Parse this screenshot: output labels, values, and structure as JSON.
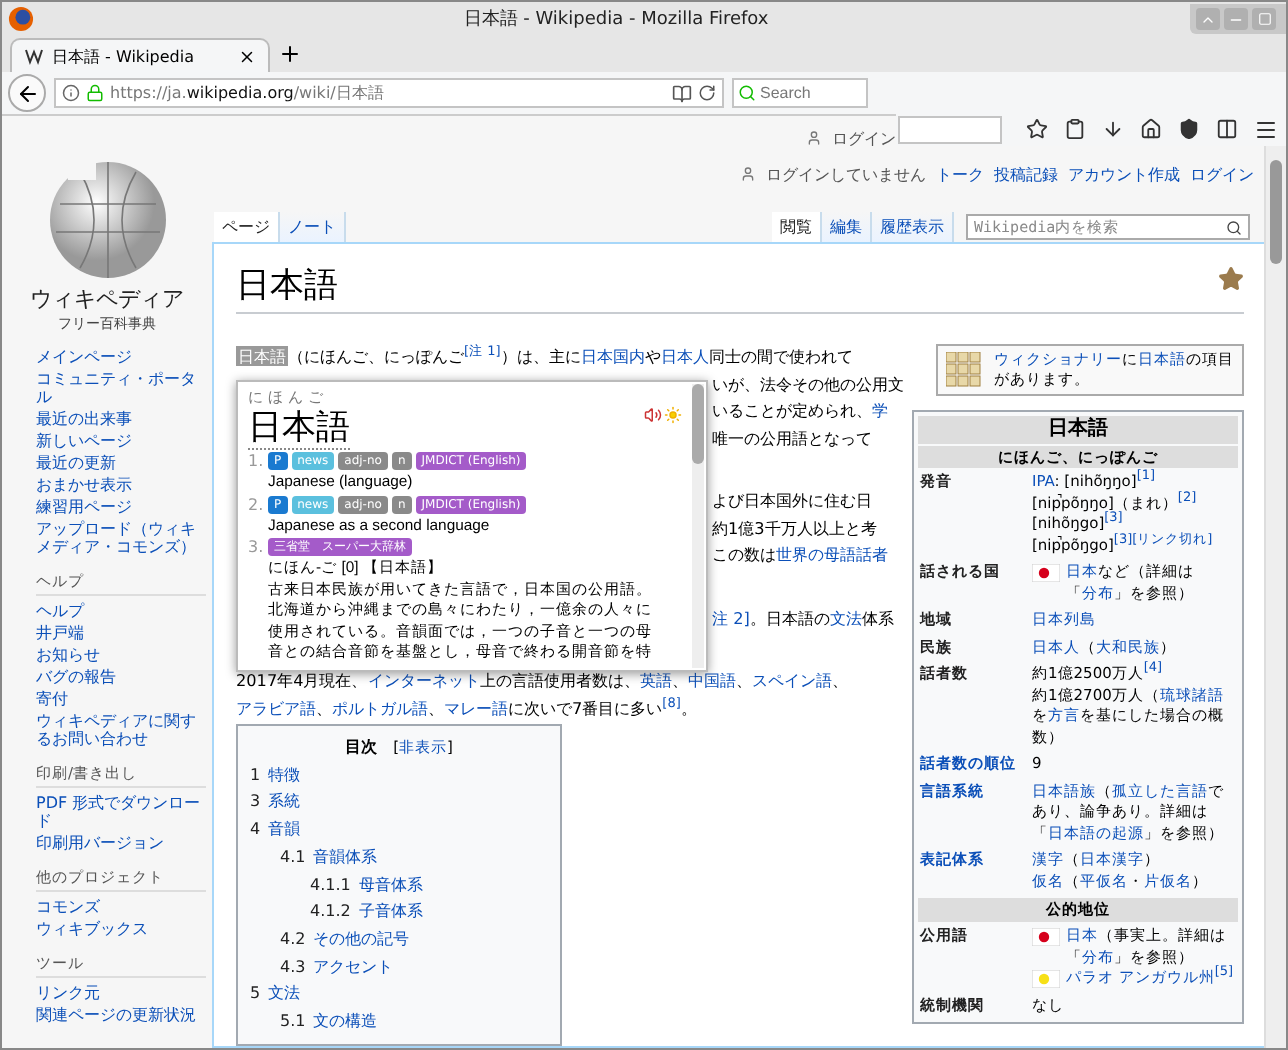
{
  "window": {
    "title": "日本語 - Wikipedia - Mozilla Firefox"
  },
  "tabs": [
    {
      "label": "日本語 - Wikipedia",
      "selected": true
    }
  ],
  "address_bar": {
    "url_prefix": "https://ja.",
    "url_domain": "wikipedia.org",
    "url_path": "/wiki/日本語"
  },
  "search_bar": {
    "placeholder": "Search"
  },
  "personal_bar": {
    "top_link": "ログイン",
    "status": "ログインしていません",
    "links": [
      "トーク",
      "投稿記録",
      "アカウント作成",
      "ログイン"
    ]
  },
  "logo": {
    "name": "ウィキペディア",
    "tagline": "フリー百科事典"
  },
  "sidebar": [
    {
      "items": [
        "メインページ",
        "コミュニティ・ポータル",
        "最近の出来事",
        "新しいページ",
        "最近の更新",
        "おまかせ表示",
        "練習用ページ",
        "アップロード（ウィキメディア・コモンズ）"
      ]
    },
    {
      "heading": "ヘルプ",
      "items": [
        "ヘルプ",
        "井戸端",
        "お知らせ",
        "バグの報告",
        "寄付",
        "ウィキペディアに関するお問い合わせ"
      ]
    },
    {
      "heading": "印刷/書き出し",
      "items": [
        "PDF 形式でダウンロード",
        "印刷用バージョン"
      ]
    },
    {
      "heading": "他のプロジェクト",
      "items": [
        "コモンズ",
        "ウィキブックス"
      ]
    },
    {
      "heading": "ツール",
      "items": [
        "リンク元",
        "関連ページの更新状況"
      ]
    }
  ],
  "page_tabs": [
    {
      "label": "ページ",
      "selected": true
    },
    {
      "label": "ノート",
      "selected": false
    }
  ],
  "view_tabs": [
    {
      "label": "閲覧",
      "selected": true
    },
    {
      "label": "編集",
      "selected": false
    },
    {
      "label": "履歴表示",
      "selected": false
    }
  ],
  "wiki_search": {
    "placeholder": "Wikipedia内を検索"
  },
  "article": {
    "title": "日本語",
    "intro": [
      {
        "kind": "mark",
        "text": "日本語"
      },
      "（にほんご、にっぽんご",
      {
        "kind": "ref",
        "text": "[注 1]"
      },
      "）は、主に",
      {
        "kind": "link",
        "text": "日本国内"
      },
      "や",
      {
        "kind": "link",
        "text": "日本人"
      },
      "同士の間で使われて"
    ],
    "covered_paragraphs": [
      [
        [
          "いが、法令その他の公用文"
        ],
        [
          "いることが定められ、",
          {
            "kind": "link",
            "text": "学"
          }
        ],
        [
          "唯一の公用語となって"
        ]
      ],
      [
        [
          "よび日本国外に住む日"
        ],
        [
          "約1億3千万人以上と考"
        ],
        [
          "この数は",
          {
            "kind": "link",
            "text": "世界の母語話者"
          }
        ]
      ],
      [
        [
          {
            "kind": "link",
            "text": "注 2]"
          },
          "。日本語の",
          {
            "kind": "link",
            "text": "文法"
          },
          "体系"
        ]
      ]
    ],
    "paragraph": [
      [
        "2017年4月現在、",
        {
          "kind": "link",
          "text": "インターネット"
        },
        "上の言語使用者数は、",
        {
          "kind": "link",
          "text": "英語"
        },
        "、",
        {
          "kind": "link",
          "text": "中国語"
        },
        "、",
        {
          "kind": "link",
          "text": "スペイン語"
        },
        "、"
      ],
      [
        {
          "kind": "link",
          "text": "アラビア語"
        },
        "、",
        {
          "kind": "link",
          "text": "ポルトガル語"
        },
        "、",
        {
          "kind": "link",
          "text": "マレー語"
        },
        "に次いで7番目に多い",
        {
          "kind": "ref",
          "text": "[8]"
        },
        "。"
      ]
    ]
  },
  "popup": {
    "reading": "にほんご",
    "word": "日本語",
    "senses": [
      {
        "number": "1.",
        "tags": [
          {
            "label": "P",
            "color": "#1a7ad0"
          },
          {
            "label": "news",
            "color": "#5bc0de"
          },
          {
            "label": "adj-no",
            "color": "#8a8a8a"
          },
          {
            "label": "n",
            "color": "#8a8a8a"
          },
          {
            "label": "JMDICT (English)",
            "color": "#a45bc9"
          }
        ],
        "lines": [
          "Japanese (language)"
        ]
      },
      {
        "number": "2.",
        "tags": [
          {
            "label": "P",
            "color": "#1a7ad0"
          },
          {
            "label": "news",
            "color": "#5bc0de"
          },
          {
            "label": "adj-no",
            "color": "#8a8a8a"
          },
          {
            "label": "n",
            "color": "#8a8a8a"
          },
          {
            "label": "JMDICT (English)",
            "color": "#a45bc9"
          }
        ],
        "lines": [
          "Japanese as a second language"
        ]
      },
      {
        "number": "3.",
        "tags": [
          {
            "label": "三省堂　スーパー大辞林",
            "color": "#a45bc9"
          }
        ],
        "lines": [
          "にほん-ご [0] 【日本語】",
          "古来日本民族が用いてきた言語で，日本国の公用語。",
          "北海道から沖縄までの島々にわたり，一億余の人々に",
          "使用されている。音韻面では，一つの子音と一つの母",
          "音との結合音節を基盤とし，母音で終わる開音節を特"
        ]
      }
    ]
  },
  "wiktionary": [
    {
      "kind": "link",
      "text": "ウィクショナリー"
    },
    "に",
    {
      "kind": "link",
      "text": "日本語"
    },
    "の項目があります。"
  ],
  "infobox": {
    "title": "日本語",
    "subtitle": "にほんご、にっぽんご",
    "rows": [
      {
        "kind": "row",
        "label": "発音",
        "label_link": false,
        "lines": [
          [
            {
              "kind": "link",
              "text": "IPA"
            },
            ": [nihõŋŋo]",
            {
              "kind": "ref",
              "text": "[1]"
            }
          ],
          [
            "[nip̚põŋŋo]（まれ）",
            {
              "kind": "ref",
              "text": "[2]"
            }
          ],
          [
            "[nihõŋgo]",
            {
              "kind": "ref",
              "text": "[3]"
            }
          ],
          [
            "[nip̚põŋgo]",
            {
              "kind": "ref",
              "text": "[3][リンク切れ]"
            }
          ]
        ]
      },
      {
        "kind": "row",
        "label": "話される国",
        "label_link": false,
        "lines": [
          [
            {
              "kind": "flag",
              "color": "#d6001c"
            },
            {
              "kind": "link",
              "text": "日本"
            },
            "など（詳細は「",
            {
              "kind": "link",
              "text": "分布"
            },
            "」を参照）"
          ]
        ]
      },
      {
        "kind": "row",
        "label": "地域",
        "label_link": false,
        "lines": [
          [
            {
              "kind": "link",
              "text": "日本列島"
            }
          ]
        ]
      },
      {
        "kind": "row",
        "label": "民族",
        "label_link": false,
        "lines": [
          [
            {
              "kind": "link",
              "text": "日本人"
            },
            "（",
            {
              "kind": "link",
              "text": "大和民族"
            },
            "）"
          ]
        ]
      },
      {
        "kind": "row",
        "label": "話者数",
        "label_link": false,
        "lines": [
          [
            "約1億2500万人",
            {
              "kind": "ref",
              "text": "[4]"
            }
          ],
          [
            "約1億2700万人（",
            {
              "kind": "link",
              "text": "琉球諸語"
            },
            "を",
            {
              "kind": "link",
              "text": "方言"
            },
            "を基にした場合の概数）"
          ]
        ]
      },
      {
        "kind": "row",
        "label": "話者数の順位",
        "label_link": true,
        "lines": [
          [
            "9"
          ]
        ]
      },
      {
        "kind": "row",
        "label": "言語系統",
        "label_link": true,
        "lines": [
          [
            {
              "kind": "link",
              "text": "日本語族"
            },
            "（",
            {
              "kind": "link",
              "text": "孤立した言語"
            },
            "であり、論争あり。詳細は「",
            {
              "kind": "link",
              "text": "日本語の起源"
            },
            "」を参照）"
          ]
        ]
      },
      {
        "kind": "row",
        "label": "表記体系",
        "label_link": true,
        "lines": [
          [
            {
              "kind": "link",
              "text": "漢字"
            },
            "（",
            {
              "kind": "link",
              "text": "日本漢字"
            },
            "）"
          ],
          [
            {
              "kind": "link",
              "text": "仮名"
            },
            "（",
            {
              "kind": "link",
              "text": "平仮名"
            },
            "・",
            {
              "kind": "link",
              "text": "片仮名"
            },
            "）"
          ]
        ]
      },
      {
        "kind": "section",
        "label": "公的地位"
      },
      {
        "kind": "row",
        "label": "公用語",
        "label_link": false,
        "lines": [
          [
            {
              "kind": "flag",
              "color": "#d6001c"
            },
            {
              "kind": "link",
              "text": "日本"
            },
            "（事実上。詳細は「",
            {
              "kind": "link",
              "text": "分布"
            },
            "」を参照）"
          ],
          [
            {
              "kind": "flag",
              "color": "#f7e017"
            },
            {
              "kind": "link",
              "text": "パラオ アンガウル州"
            },
            {
              "kind": "ref",
              "text": "[5]"
            }
          ]
        ]
      },
      {
        "kind": "row",
        "label": "統制機関",
        "label_link": false,
        "lines": [
          [
            "なし"
          ]
        ]
      }
    ]
  },
  "toc": {
    "title": "目次",
    "toggle": [
      "[",
      {
        "kind": "link",
        "text": "非表示"
      },
      "]"
    ],
    "items": [
      {
        "number": "1",
        "label": "特徴"
      },
      {
        "number": "3",
        "label": "系統"
      },
      {
        "number": "4",
        "label": "音韻",
        "children": [
          {
            "number": "4.1",
            "label": "音韻体系",
            "children": [
              {
                "number": "4.1.1",
                "label": "母音体系"
              },
              {
                "number": "4.1.2",
                "label": "子音体系"
              }
            ]
          },
          {
            "number": "4.2",
            "label": "その他の記号"
          },
          {
            "number": "4.3",
            "label": "アクセント"
          }
        ]
      },
      {
        "number": "5",
        "label": "文法",
        "children": [
          {
            "number": "5.1",
            "label": "文の構造"
          }
        ]
      }
    ]
  }
}
